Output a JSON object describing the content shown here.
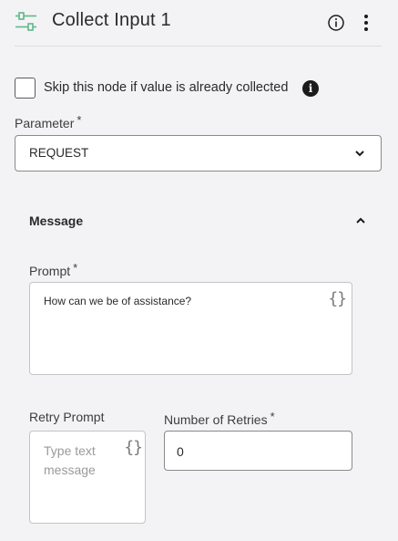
{
  "header": {
    "title": "Collect Input 1",
    "node_icon": "workflow-node-icon",
    "info_icon": "info-circle-icon",
    "more_icon": "more-vertical-icon"
  },
  "skip": {
    "label": "Skip this node if value is already collected",
    "checked": false,
    "info_icon": "info-filled-icon"
  },
  "parameter": {
    "label": "Parameter",
    "required_mark": "*",
    "value": "REQUEST"
  },
  "message_section": {
    "label": "Message",
    "expanded": true
  },
  "prompt": {
    "label": "Prompt",
    "required_mark": "*",
    "value": "How can we be of assistance?",
    "variable_icon": "{}"
  },
  "retry_prompt": {
    "label": "Retry Prompt",
    "placeholder": "Type text message",
    "variable_icon": "{}"
  },
  "retries": {
    "label": "Number of Retries",
    "required_mark": "*",
    "value": "0"
  },
  "colors": {
    "accent": "#5fb98a",
    "background": "#f3f3f5",
    "border": "#8a8a8a"
  }
}
